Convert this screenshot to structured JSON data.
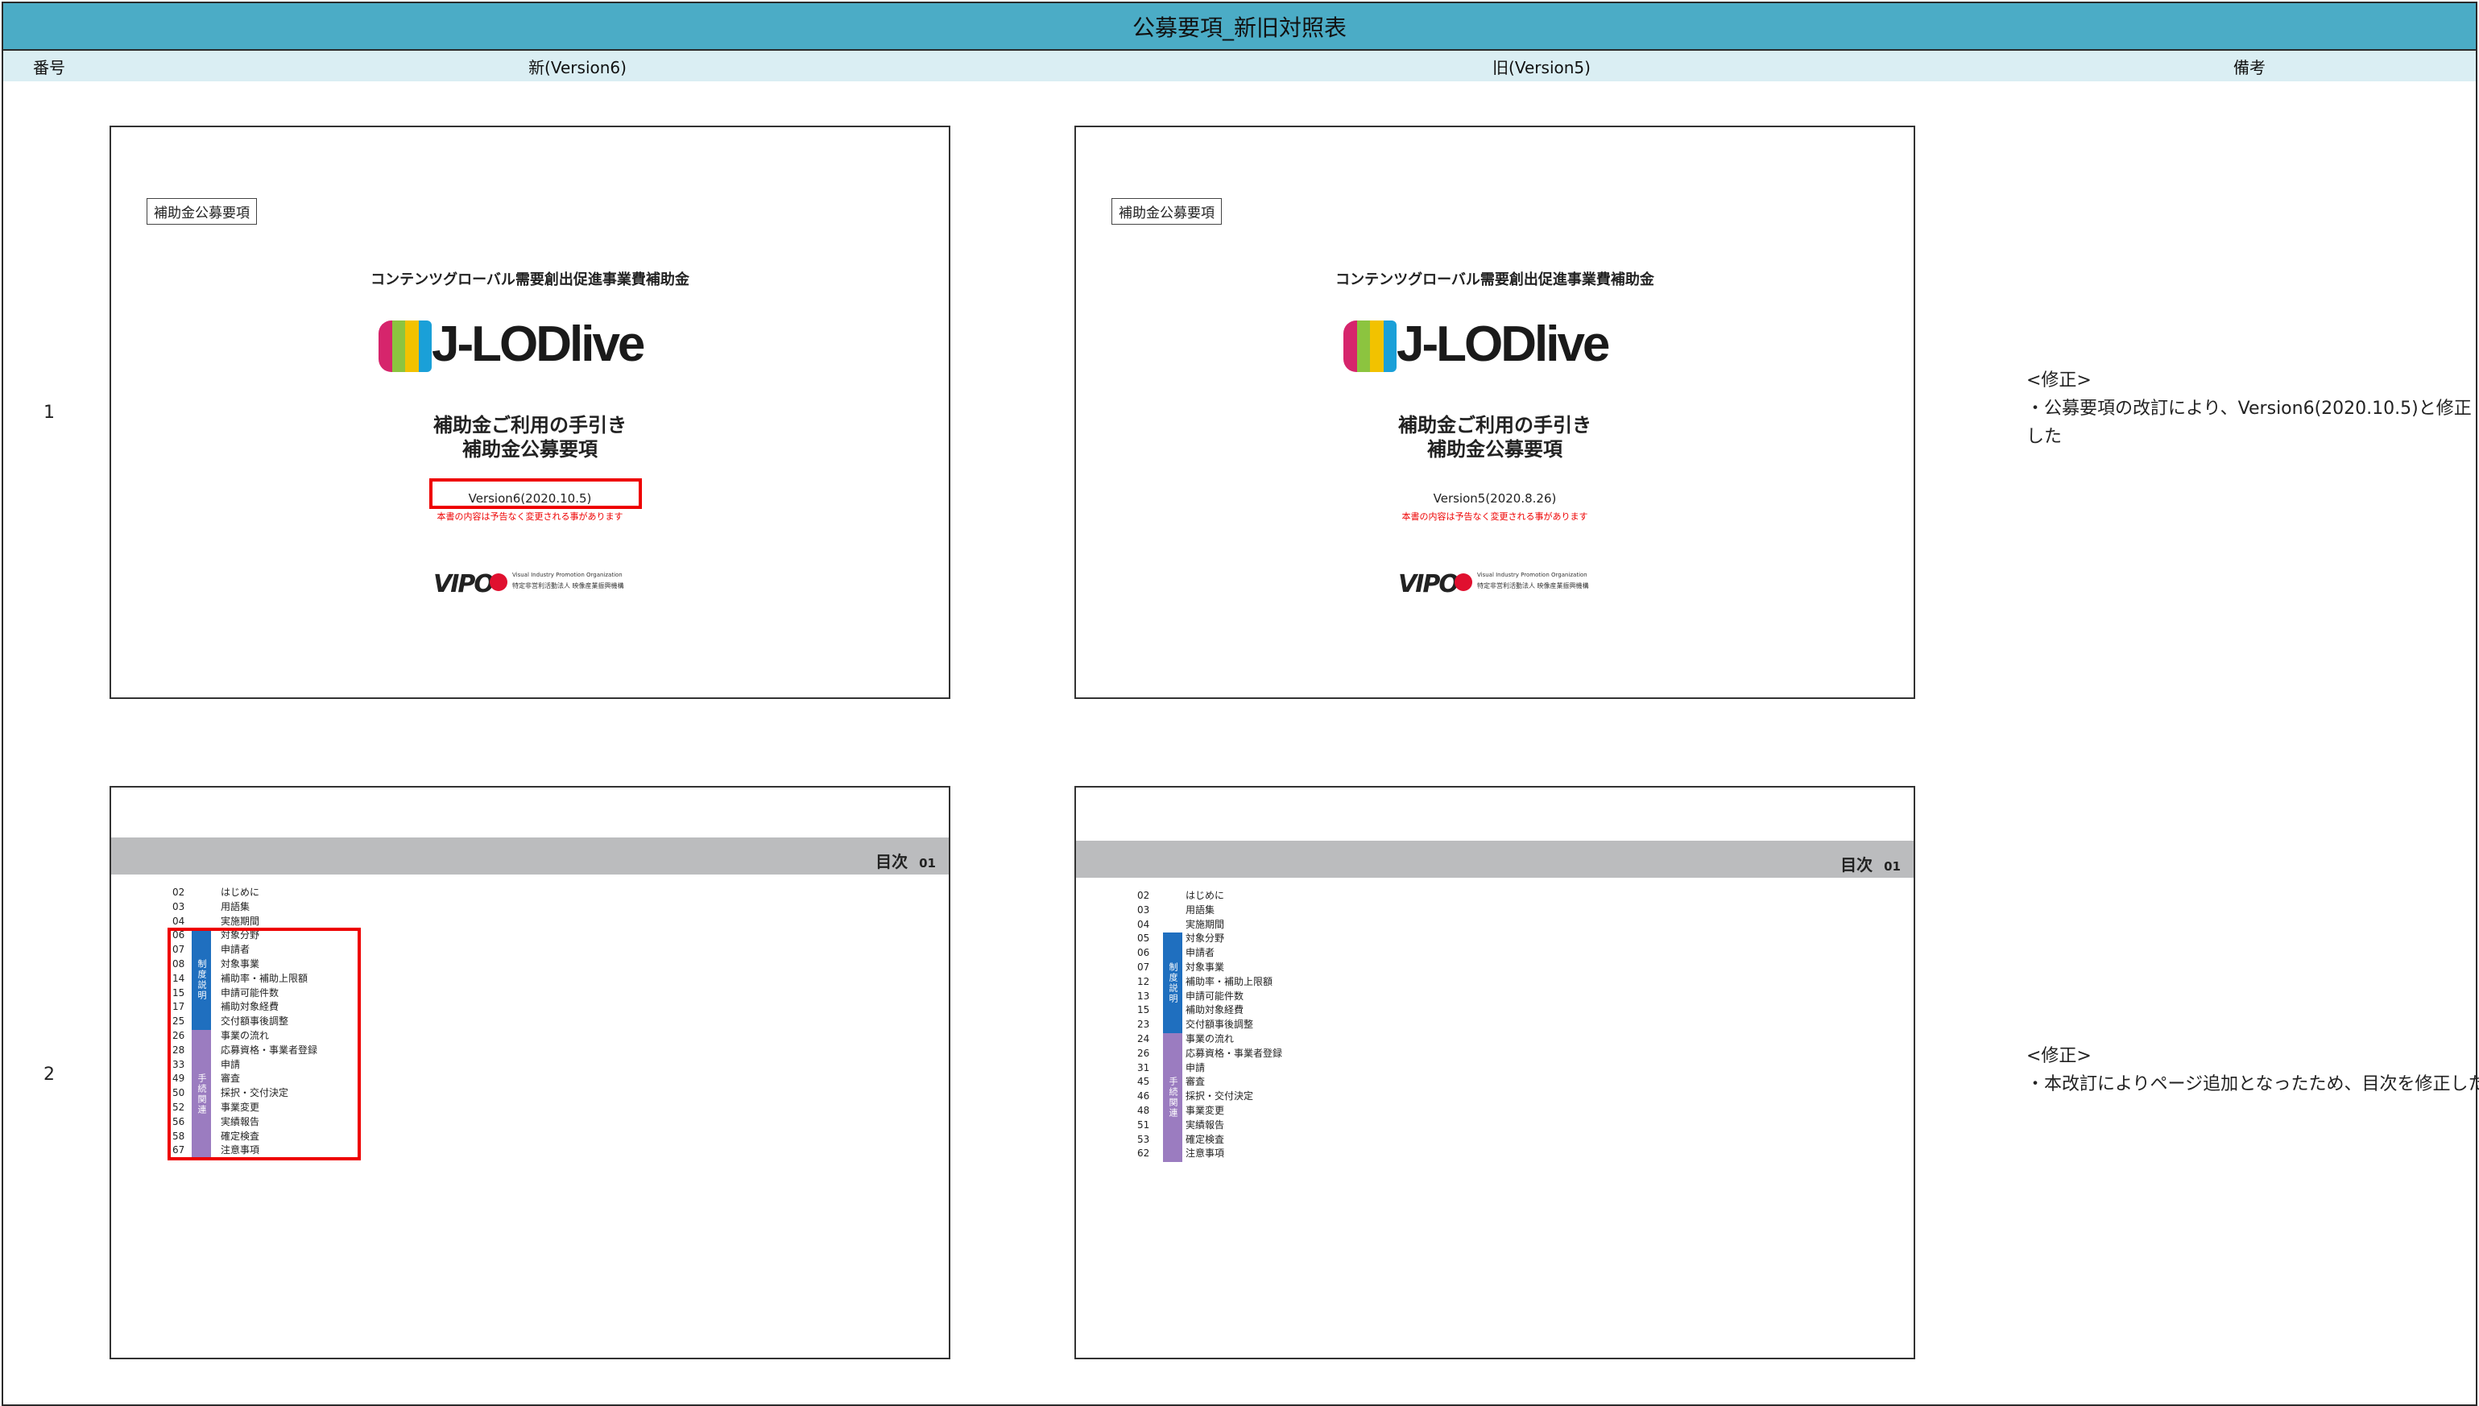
{
  "title": "公募要項_新旧対照表",
  "headers": {
    "num": "番号",
    "new": "新(Version6)",
    "old": "旧(Version5)",
    "note": "備考"
  },
  "rows": [
    {
      "num": "1",
      "new": {
        "tag": "補助金公募要項",
        "subtitle": "コンテンツグローバル需要創出促進事業費補助金",
        "logo": "J-LODlive",
        "title1": "補助金ご利用の手引き",
        "title2": "補助金公募要項",
        "version": "Version6(2020.10.5)",
        "note": "本書の内容は予告なく変更される事があります",
        "org_en": "Visual Industry Promotion Organization",
        "org_jp": "特定非営利活動法人 映像産業振興機構"
      },
      "old": {
        "tag": "補助金公募要項",
        "subtitle": "コンテンツグローバル需要創出促進事業費補助金",
        "logo": "J-LODlive",
        "title1": "補助金ご利用の手引き",
        "title2": "補助金公募要項",
        "version": "Version5(2020.8.26)",
        "note": "本書の内容は予告なく変更される事があります",
        "org_en": "Visual Industry Promotion Organization",
        "org_jp": "特定非営利活動法人 映像産業振興機構"
      },
      "remark": [
        "<修正>",
        "・公募要項の改訂により、Version6(2020.10.5)と修正",
        "した"
      ]
    },
    {
      "num": "2",
      "new": {
        "toc_title": "目次",
        "toc_page": "01",
        "side1": "制度説明",
        "side2": "手続関連",
        "items": [
          {
            "pg": "02",
            "label": "はじめに"
          },
          {
            "pg": "03",
            "label": "用語集"
          },
          {
            "pg": "04",
            "label": "実施期間"
          },
          {
            "pg": "06",
            "label": "対象分野"
          },
          {
            "pg": "07",
            "label": "申請者"
          },
          {
            "pg": "08",
            "label": "対象事業"
          },
          {
            "pg": "14",
            "label": "補助率・補助上限額"
          },
          {
            "pg": "15",
            "label": "申請可能件数"
          },
          {
            "pg": "17",
            "label": "補助対象経費"
          },
          {
            "pg": "25",
            "label": "交付額事後調整"
          },
          {
            "pg": "26",
            "label": "事業の流れ"
          },
          {
            "pg": "28",
            "label": "応募資格・事業者登録"
          },
          {
            "pg": "33",
            "label": "申請"
          },
          {
            "pg": "49",
            "label": "審査"
          },
          {
            "pg": "50",
            "label": "採択・交付決定"
          },
          {
            "pg": "52",
            "label": "事業変更"
          },
          {
            "pg": "56",
            "label": "実績報告"
          },
          {
            "pg": "58",
            "label": "確定検査"
          },
          {
            "pg": "67",
            "label": "注意事項"
          }
        ]
      },
      "old": {
        "toc_title": "目次",
        "toc_page": "01",
        "side1": "制度説明",
        "side2": "手続関連",
        "items": [
          {
            "pg": "02",
            "label": "はじめに"
          },
          {
            "pg": "03",
            "label": "用語集"
          },
          {
            "pg": "04",
            "label": "実施期間"
          },
          {
            "pg": "05",
            "label": "対象分野"
          },
          {
            "pg": "06",
            "label": "申請者"
          },
          {
            "pg": "07",
            "label": "対象事業"
          },
          {
            "pg": "12",
            "label": "補助率・補助上限額"
          },
          {
            "pg": "13",
            "label": "申請可能件数"
          },
          {
            "pg": "15",
            "label": "補助対象経費"
          },
          {
            "pg": "23",
            "label": "交付額事後調整"
          },
          {
            "pg": "24",
            "label": "事業の流れ"
          },
          {
            "pg": "26",
            "label": "応募資格・事業者登録"
          },
          {
            "pg": "31",
            "label": "申請"
          },
          {
            "pg": "45",
            "label": "審査"
          },
          {
            "pg": "46",
            "label": "採択・交付決定"
          },
          {
            "pg": "48",
            "label": "事業変更"
          },
          {
            "pg": "51",
            "label": "実績報告"
          },
          {
            "pg": "53",
            "label": "確定検査"
          },
          {
            "pg": "62",
            "label": "注意事項"
          }
        ]
      },
      "remark": [
        "<修正>",
        "・本改訂によりページ追加となったため、目次を修正した"
      ]
    }
  ],
  "colors": {
    "title_bar": "#4BACC6",
    "header": "#DAEEF3",
    "highlight": "#e00000",
    "toc_blue": "#1f6fbf",
    "toc_purple": "#9b7cc0"
  }
}
